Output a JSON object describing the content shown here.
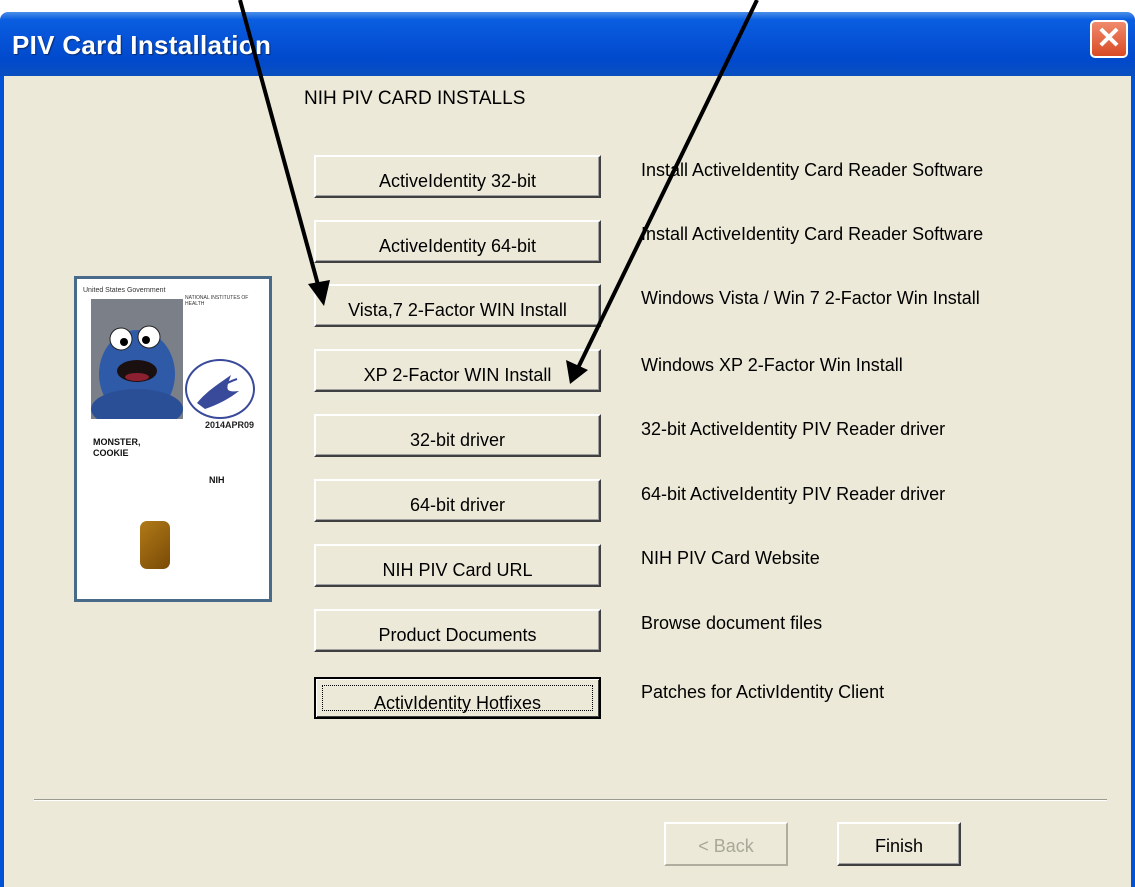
{
  "window": {
    "title": "PIV Card Installation",
    "close_glyph": "✕"
  },
  "heading": "NIH PIV CARD INSTALLS",
  "rows": [
    {
      "button": "ActiveIdentity 32-bit",
      "description": "Install ActiveIdentity Card Reader Software"
    },
    {
      "button": "ActiveIdentity 64-bit",
      "description": "Install ActiveIdentity Card Reader Software"
    },
    {
      "button": "Vista,7 2-Factor WIN Install",
      "description": "Windows Vista / Win 7 2-Factor Win Install"
    },
    {
      "button": "XP 2-Factor WIN Install",
      "description": "Windows XP 2-Factor Win Install"
    },
    {
      "button": "32-bit driver",
      "description": "32-bit ActiveIdentity PIV Reader driver"
    },
    {
      "button": "64-bit driver",
      "description": "64-bit ActiveIdentity PIV Reader driver"
    },
    {
      "button": "NIH PIV Card URL",
      "description": "NIH PIV Card Website"
    },
    {
      "button": "Product Documents",
      "description": "Browse document files"
    },
    {
      "button": "ActivIdentity Hotfixes",
      "description": "Patches for ActivIdentity Client"
    }
  ],
  "card": {
    "header": "United States Government",
    "institute": "NATIONAL INSTITUTES OF HEALTH",
    "expiry": "2014APR09",
    "name_line1": "MONSTER,",
    "name_line2": "COOKIE",
    "agency": "NIH"
  },
  "footer": {
    "back_label": "< Back",
    "finish_label": "Finish",
    "back_enabled": false
  },
  "colors": {
    "titlebar": "#0052d6",
    "face": "#ece9d8",
    "close": "#d84a24",
    "annotation_arrows": "#000000"
  }
}
